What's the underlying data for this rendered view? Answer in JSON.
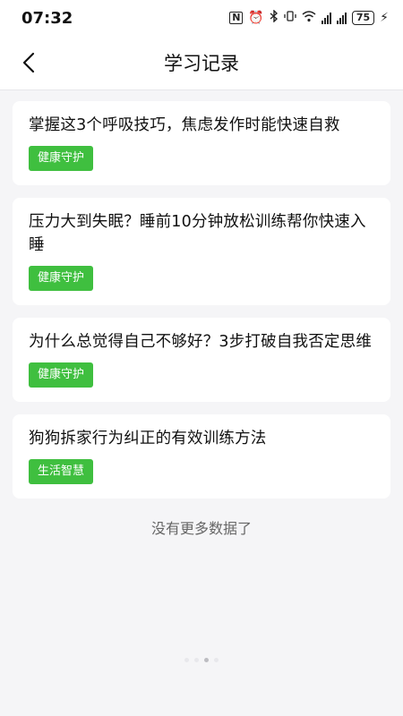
{
  "status_bar": {
    "time": "07:32",
    "nfc_label": "N",
    "battery": "75"
  },
  "header": {
    "title": "学习记录"
  },
  "records": [
    {
      "title": "掌握这3个呼吸技巧，焦虑发作时能快速自救",
      "tag": "健康守护"
    },
    {
      "title": "压力大到失眠？睡前10分钟放松训练帮你快速入睡",
      "tag": "健康守护"
    },
    {
      "title": "为什么总觉得自己不够好？3步打破自我否定思维",
      "tag": "健康守护"
    },
    {
      "title": "狗狗拆家行为纠正的有效训练方法",
      "tag": "生活智慧"
    }
  ],
  "footer": {
    "no_more_text": "没有更多数据了"
  },
  "colors": {
    "tag_bg": "#3fbf3f",
    "page_bg": "#f5f5f7"
  }
}
